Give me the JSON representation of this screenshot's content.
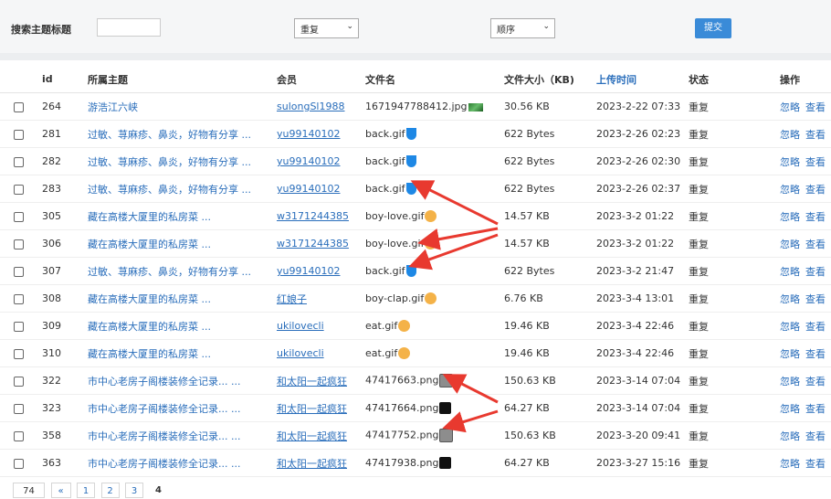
{
  "filters": {
    "search_label": "搜索主题标题",
    "search_value": "",
    "select1_value": "重复",
    "select2_value": "顺序",
    "submit_label": "提交"
  },
  "columns": [
    "id",
    "所属主题",
    "会员",
    "文件名",
    "文件大小（KB)",
    "上传时间",
    "状态",
    "操作"
  ],
  "rows": [
    {
      "id": "264",
      "topic": "游浩江六峡",
      "member": "sulongSl1988",
      "file": "1671947788412.jpg",
      "thumb": "green",
      "size": "30.56 KB",
      "time": "2023-2-22 07:33",
      "status": "重复",
      "a1": "忽略",
      "a2": "查看"
    },
    {
      "id": "281",
      "topic": "过敏、荨麻疹、鼻炎，好物有分享 ...",
      "member": "yu99140102",
      "file": "back.gif",
      "thumb": "blue",
      "size": "622 Bytes",
      "time": "2023-2-26 02:23",
      "status": "重复",
      "a1": "忽略",
      "a2": "查看"
    },
    {
      "id": "282",
      "topic": "过敏、荨麻疹、鼻炎，好物有分享 ...",
      "member": "yu99140102",
      "file": "back.gif",
      "thumb": "blue",
      "size": "622 Bytes",
      "time": "2023-2-26 02:30",
      "status": "重复",
      "a1": "忽略",
      "a2": "查看"
    },
    {
      "id": "283",
      "topic": "过敏、荨麻疹、鼻炎，好物有分享 ...",
      "member": "yu99140102",
      "file": "back.gif",
      "thumb": "blue",
      "size": "622 Bytes",
      "time": "2023-2-26 02:37",
      "status": "重复",
      "a1": "忽略",
      "a2": "查看"
    },
    {
      "id": "305",
      "topic": "藏在高楼大厦里的私房菜 ...",
      "member": "w3171244385",
      "file": "boy-love.gif",
      "thumb": "cat",
      "size": "14.57 KB",
      "time": "2023-3-2 01:22",
      "status": "重复",
      "a1": "忽略",
      "a2": "查看"
    },
    {
      "id": "306",
      "topic": "藏在高楼大厦里的私房菜 ...",
      "member": "w3171244385",
      "file": "boy-love.gif",
      "thumb": "cat",
      "size": "14.57 KB",
      "time": "2023-3-2 01:22",
      "status": "重复",
      "a1": "忽略",
      "a2": "查看"
    },
    {
      "id": "307",
      "topic": "过敏、荨麻疹、鼻炎，好物有分享 ...",
      "member": "yu99140102",
      "file": "back.gif",
      "thumb": "blue",
      "size": "622 Bytes",
      "time": "2023-3-2 21:47",
      "status": "重复",
      "a1": "忽略",
      "a2": "查看"
    },
    {
      "id": "308",
      "topic": "藏在高楼大厦里的私房菜 ...",
      "member": "红娘子",
      "file": "boy-clap.gif",
      "thumb": "cat",
      "size": "6.76 KB",
      "time": "2023-3-4 13:01",
      "status": "重复",
      "a1": "忽略",
      "a2": "查看"
    },
    {
      "id": "309",
      "topic": "藏在高楼大厦里的私房菜 ...",
      "member": "ukilovecli",
      "file": "eat.gif",
      "thumb": "cat",
      "size": "19.46 KB",
      "time": "2023-3-4 22:46",
      "status": "重复",
      "a1": "忽略",
      "a2": "查看"
    },
    {
      "id": "310",
      "topic": "藏在高楼大厦里的私房菜 ...",
      "member": "ukilovecli",
      "file": "eat.gif",
      "thumb": "cat",
      "size": "19.46 KB",
      "time": "2023-3-4 22:46",
      "status": "重复",
      "a1": "忽略",
      "a2": "查看"
    },
    {
      "id": "322",
      "topic": "市中心老房子阁楼装修全记录... ...",
      "member": "和太阳一起疯狂",
      "file": "47417663.png",
      "thumb": "photo",
      "size": "150.63 KB",
      "time": "2023-3-14 07:04",
      "status": "重复",
      "a1": "忽略",
      "a2": "查看"
    },
    {
      "id": "323",
      "topic": "市中心老房子阁楼装修全记录... ...",
      "member": "和太阳一起疯狂",
      "file": "47417664.png",
      "thumb": "black",
      "size": "64.27 KB",
      "time": "2023-3-14 07:04",
      "status": "重复",
      "a1": "忽略",
      "a2": "查看"
    },
    {
      "id": "358",
      "topic": "市中心老房子阁楼装修全记录... ...",
      "member": "和太阳一起疯狂",
      "file": "47417752.png",
      "thumb": "photo",
      "size": "150.63 KB",
      "time": "2023-3-20 09:41",
      "status": "重复",
      "a1": "忽略",
      "a2": "查看"
    },
    {
      "id": "363",
      "topic": "市中心老房子阁楼装修全记录... ...",
      "member": "和太阳一起疯狂",
      "file": "47417938.png",
      "thumb": "black",
      "size": "64.27 KB",
      "time": "2023-3-27 15:16",
      "status": "重复",
      "a1": "忽略",
      "a2": "查看"
    }
  ],
  "pagination": {
    "total": "74",
    "prev": "«",
    "pages": [
      "1",
      "2",
      "3"
    ],
    "current": "4"
  },
  "colors": {
    "link": "#2a6ebb",
    "submit": "#3a8bd8",
    "arrow": "#e8392f"
  }
}
